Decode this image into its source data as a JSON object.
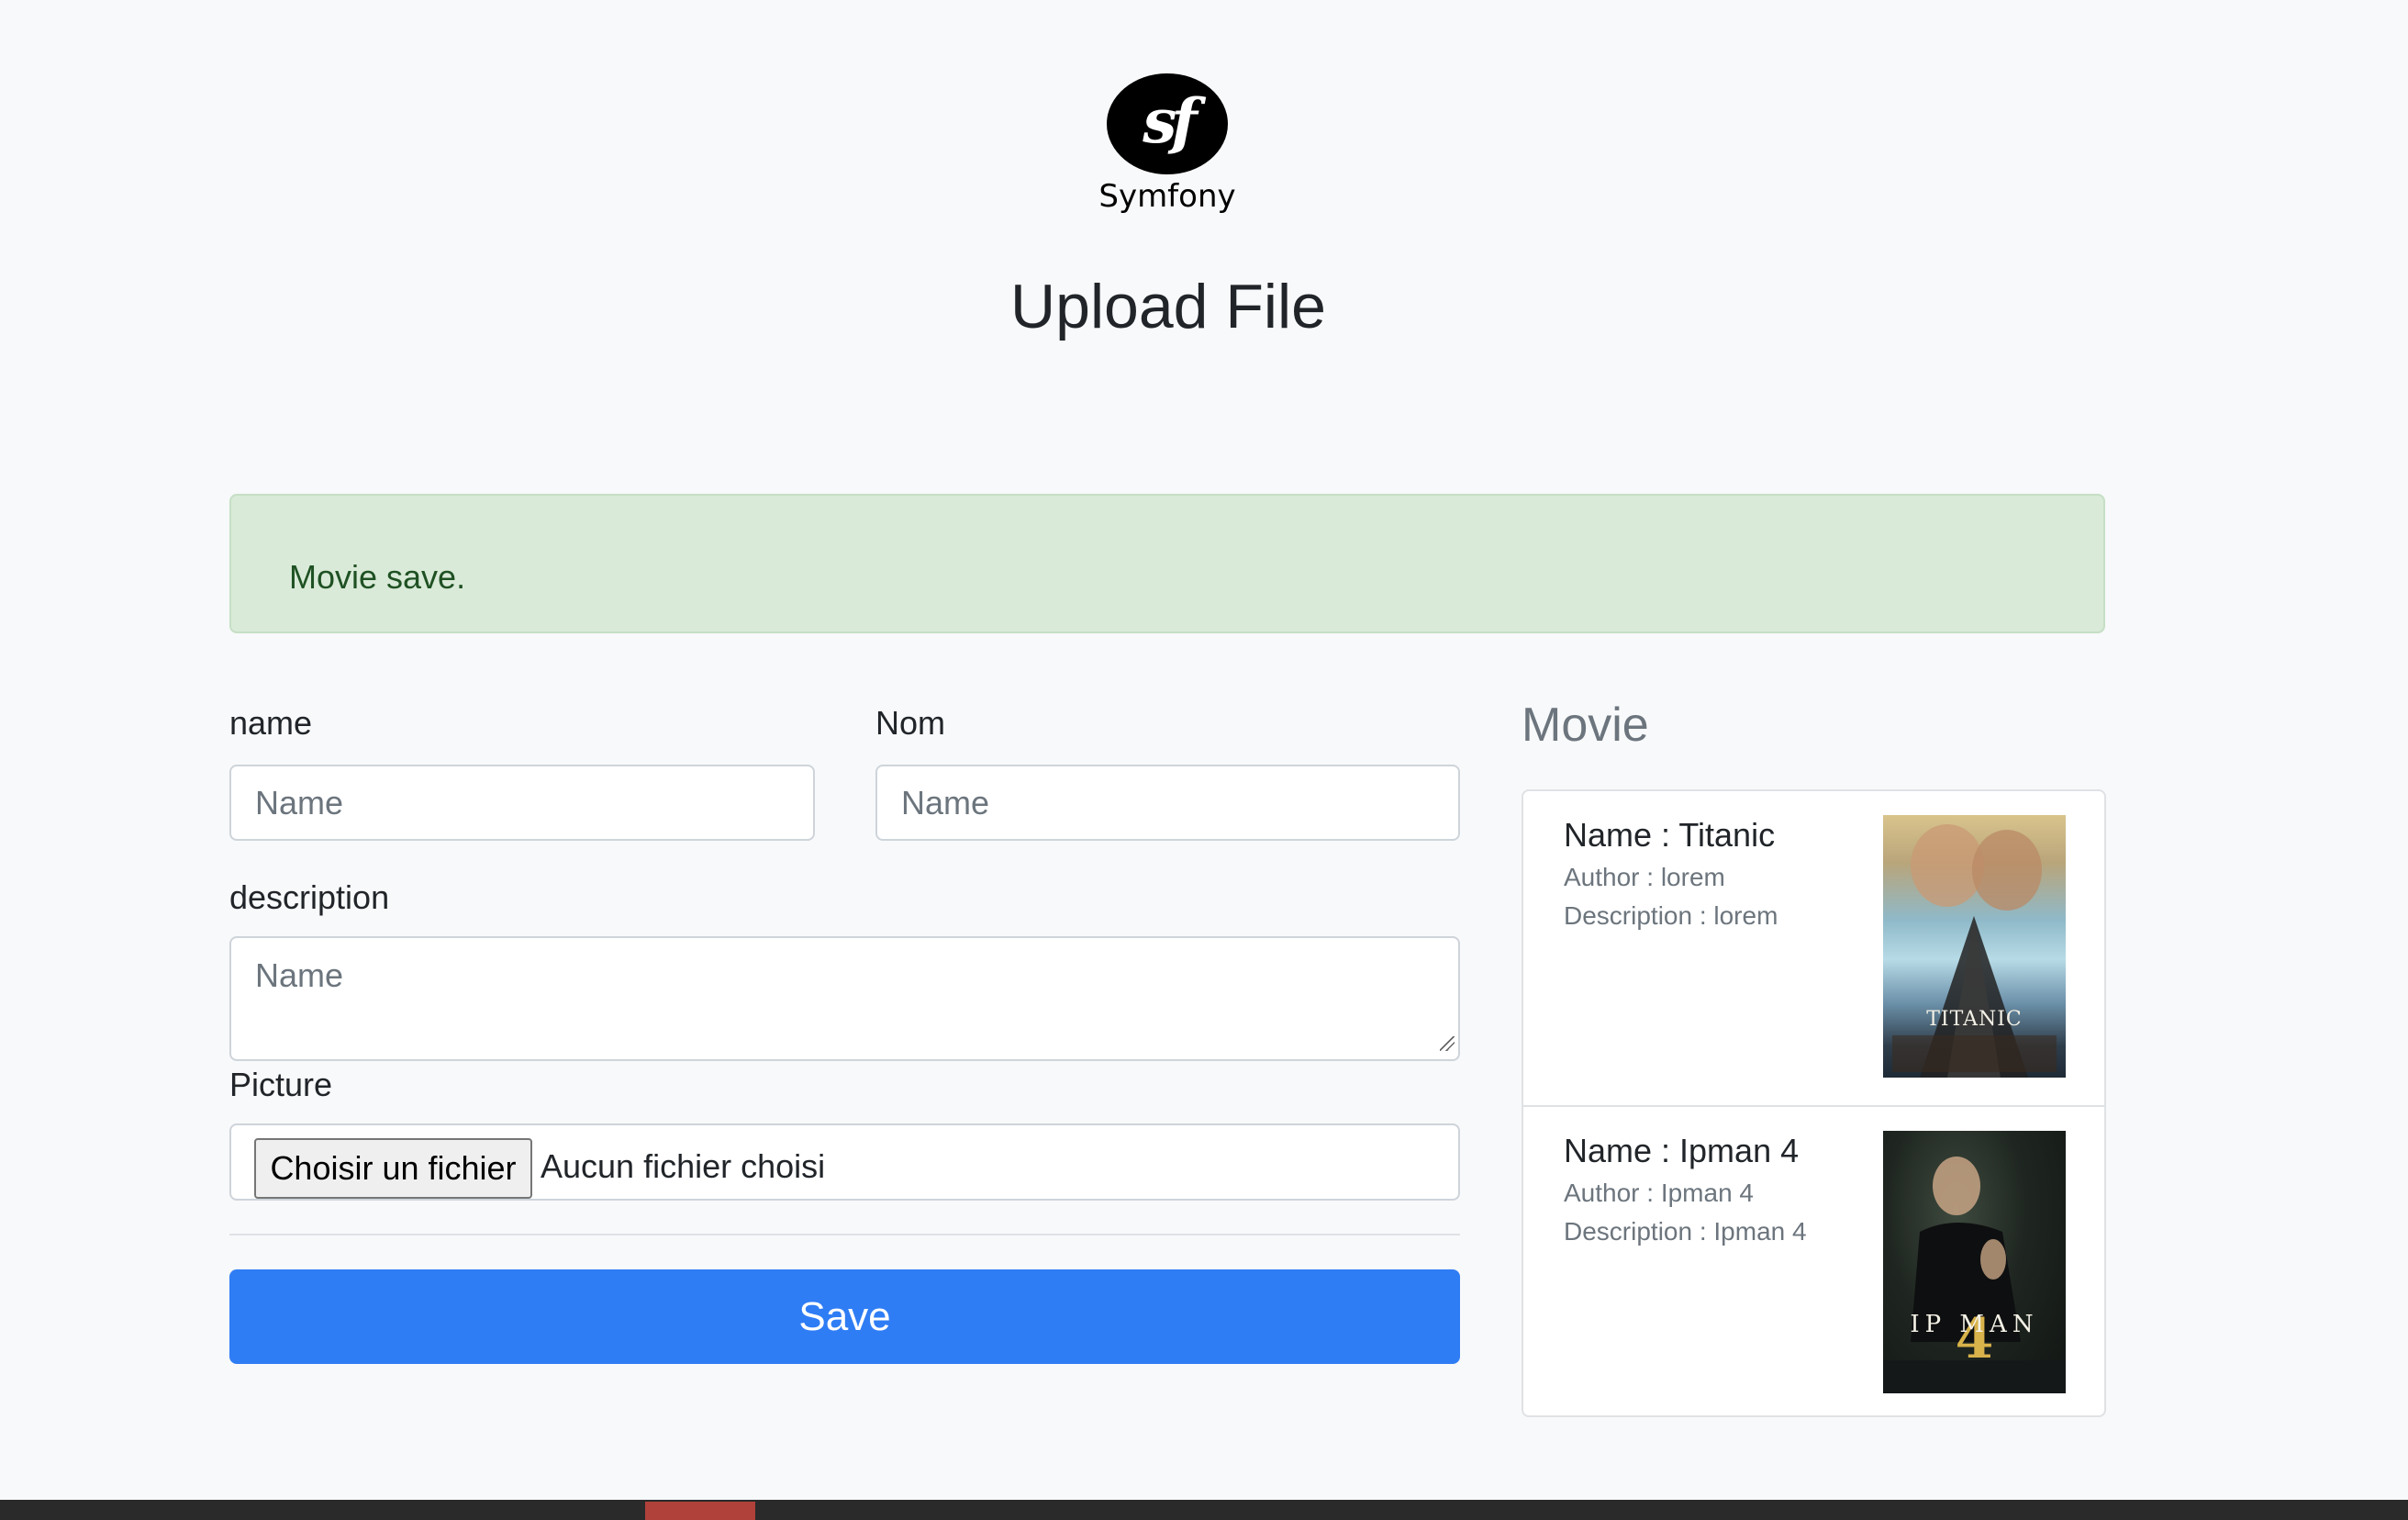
{
  "brand": {
    "logo_glyph": "sf",
    "name": "Symfony"
  },
  "page": {
    "title": "Upload File"
  },
  "alert": {
    "message": "Movie save."
  },
  "form": {
    "name_label": "name",
    "name_placeholder": "Name",
    "nom_label": "Nom",
    "nom_placeholder": "Name",
    "description_label": "description",
    "description_placeholder": "Name",
    "picture_label": "Picture",
    "file_button_label": "Choisir un fichier",
    "file_status": "Aucun fichier choisi",
    "save_label": "Save"
  },
  "movies": {
    "heading": "Movie",
    "items": [
      {
        "name": "Name : Titanic",
        "author": "Author : lorem",
        "description": "Description : lorem",
        "poster_text": "TITANIC"
      },
      {
        "name": "Name : Ipman 4",
        "author": "Author : Ipman 4",
        "description": "Description : Ipman 4",
        "poster_text": "IP MAN",
        "poster_number": "4"
      }
    ]
  },
  "colors": {
    "background": "#f8f9fa",
    "alert_bg": "#d9ead8",
    "alert_text": "#1f5123",
    "primary": "#2f7df5",
    "muted": "#6c757d"
  }
}
